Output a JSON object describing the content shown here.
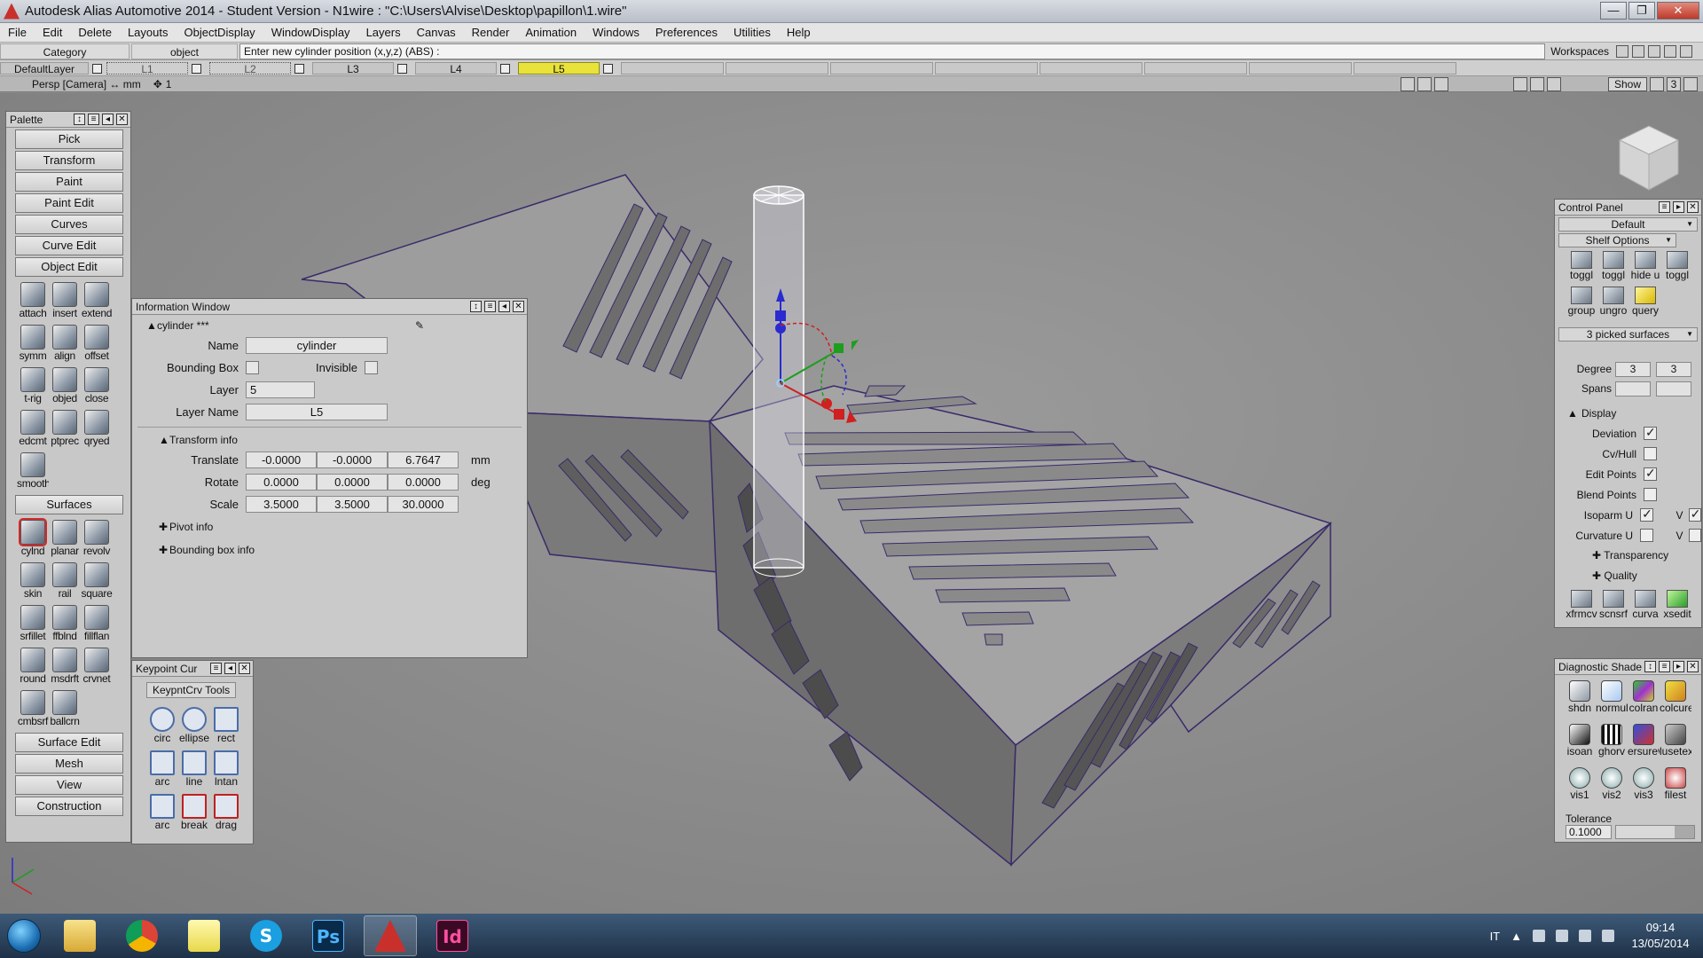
{
  "window": {
    "title": "Autodesk Alias Automotive 2014   - Student Version   - N1wire : \"C:\\Users\\Alvise\\Desktop\\papillon\\1.wire\"",
    "btn_min": "—",
    "btn_max": "❐",
    "btn_close": "✕"
  },
  "menu": [
    "File",
    "Edit",
    "Delete",
    "Layouts",
    "ObjectDisplay",
    "WindowDisplay",
    "Layers",
    "Canvas",
    "Render",
    "Animation",
    "Windows",
    "Preferences",
    "Utilities",
    "Help"
  ],
  "promptbar": {
    "category": "Category",
    "object": "object",
    "prompt": "Enter new cylinder position (x,y,z) (ABS) :",
    "workspaces": "Workspaces"
  },
  "layers": {
    "default": "DefaultLayer",
    "l1": "L1",
    "l2": "L2",
    "l3": "L3",
    "l4": "L4",
    "l5": "L5"
  },
  "viewport": {
    "title": "Persp [Camera]  ↔ mm",
    "snap": "1",
    "show": "Show",
    "num": "3"
  },
  "palette": {
    "title": "Palette",
    "buttons": [
      "Pick",
      "Transform",
      "Paint",
      "Paint Edit",
      "Curves",
      "Curve Edit",
      "Object Edit"
    ],
    "object_edit_tools": [
      "attach",
      "insert",
      "extend",
      "symm",
      "align",
      "offset",
      "t-rig",
      "objed",
      "close",
      "edcmt",
      "ptprec",
      "qryed",
      "smooth"
    ],
    "surfaces_btn": "Surfaces",
    "surface_tools": [
      "cylnd",
      "planar",
      "revolv",
      "skin",
      "rail",
      "square",
      "srfillet",
      "ffblnd",
      "fillflan",
      "round",
      "msdrft",
      "crvnet",
      "cmbsrf",
      "ballcrn"
    ],
    "bottom_buttons": [
      "Surface Edit",
      "Mesh",
      "View",
      "Construction"
    ]
  },
  "info_window": {
    "title": "Information Window",
    "object_label": "cylinder ***",
    "name_label": "Name",
    "name_value": "cylinder",
    "bbox_label": "Bounding Box",
    "invisible_label": "Invisible",
    "layer_label": "Layer",
    "layer_value": "5",
    "layer_name_label": "Layer Name",
    "layer_name_value": "L5",
    "transform_label": "Transform info",
    "translate_label": "Translate",
    "translate": [
      "-0.0000",
      "-0.0000",
      "6.7647"
    ],
    "translate_unit": "mm",
    "rotate_label": "Rotate",
    "rotate": [
      "0.0000",
      "0.0000",
      "0.0000"
    ],
    "rotate_unit": "deg",
    "scale_label": "Scale",
    "scale": [
      "3.5000",
      "3.5000",
      "30.0000"
    ],
    "pivot_label": "Pivot info",
    "bbinfo_label": "Bounding box info"
  },
  "keypoint_window": {
    "title": "Keypoint Cur",
    "tab": "KeypntCrv Tools",
    "tools": [
      "circ",
      "ellipse",
      "rect",
      "arc",
      "line",
      "lntan",
      "arc",
      "break",
      "drag"
    ]
  },
  "control_panel": {
    "title": "Control Panel",
    "preset": "Default",
    "shelf_options": "Shelf Options",
    "shelf_items": [
      "toggl",
      "toggl",
      "hide u",
      "toggl",
      "group",
      "ungro",
      "query"
    ],
    "picked": "3 picked surfaces",
    "degree_label": "Degree",
    "degree_u": "3",
    "degree_v": "3",
    "spans_label": "Spans",
    "display_label": "Display",
    "deviation": "Deviation",
    "cvhull": "Cv/Hull",
    "edit_points": "Edit Points",
    "blend_points": "Blend Points",
    "isoparm_u": "Isoparm U",
    "curvature_u": "Curvature U",
    "v_label": "V",
    "transparency": "Transparency",
    "quality": "Quality",
    "bottom_tools": [
      "xfrmcv",
      "scnsrf",
      "curva",
      "xsedit"
    ]
  },
  "diag_shade": {
    "title": "Diagnostic Shade",
    "items": [
      "shdn",
      "normul",
      "colran",
      "colcurevl",
      "isoan",
      "ghorv",
      "ersurev",
      "lusetex",
      "vis1",
      "vis2",
      "vis3",
      "filest"
    ],
    "tolerance_label": "Tolerance",
    "tolerance_value": "0.1000"
  },
  "taskbar": {
    "ps": "Ps",
    "id": "Id",
    "skype": "S",
    "lang": "IT",
    "time": "09:14",
    "date": "13/05/2014"
  },
  "colors": {
    "active_layer": "#e8e23a",
    "surface": "#9a9a9a",
    "wire": "#3a2a6a"
  }
}
